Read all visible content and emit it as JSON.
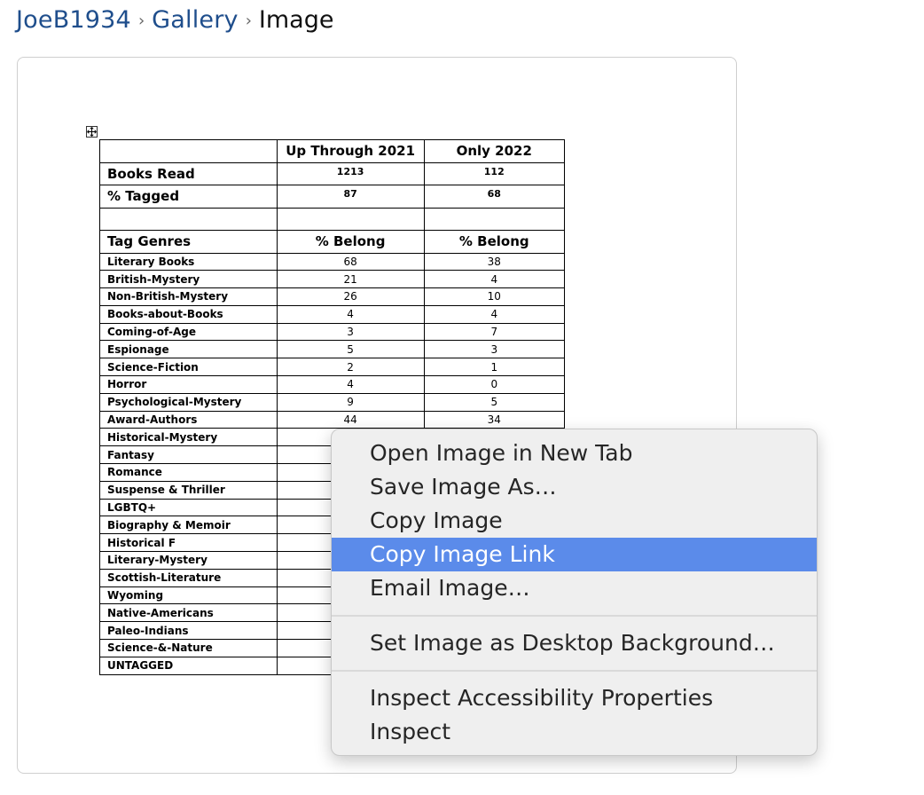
{
  "breadcrumb": {
    "user": "JoeB1934",
    "gallery": "Gallery",
    "current": "Image",
    "separator": "›"
  },
  "table": {
    "header": [
      "",
      "Up Through 2021",
      "Only 2022"
    ],
    "summary_rows": [
      [
        "Books Read",
        "1213",
        "112"
      ],
      [
        "% Tagged",
        "87",
        "68"
      ],
      [
        "",
        "",
        ""
      ],
      [
        "Tag Genres",
        "% Belong",
        "% Belong"
      ]
    ],
    "rows": [
      [
        "Literary Books",
        "68",
        "38"
      ],
      [
        "British-Mystery",
        "21",
        "4"
      ],
      [
        "Non-British-Mystery",
        "26",
        "10"
      ],
      [
        "Books-about-Books",
        "4",
        "4"
      ],
      [
        "Coming-of-Age",
        "3",
        "7"
      ],
      [
        "Espionage",
        "5",
        "3"
      ],
      [
        "Science-Fiction",
        "2",
        "1"
      ],
      [
        "Horror",
        "4",
        "0"
      ],
      [
        "Psychological-Mystery",
        "9",
        "5"
      ],
      [
        "Award-Authors",
        "44",
        "34"
      ],
      [
        "Historical-Mystery",
        "",
        ""
      ],
      [
        "Fantasy",
        "",
        ""
      ],
      [
        "Romance",
        "",
        ""
      ],
      [
        "Suspense & Thriller",
        "",
        ""
      ],
      [
        "LGBTQ+",
        "",
        ""
      ],
      [
        "Biography & Memoir",
        "",
        ""
      ],
      [
        "Historical F",
        "",
        ""
      ],
      [
        "Literary-Mystery",
        "",
        ""
      ],
      [
        "Scottish-Literature",
        "",
        ""
      ],
      [
        "Wyoming",
        "",
        ""
      ],
      [
        "Native-Americans",
        "",
        ""
      ],
      [
        "Paleo-Indians",
        "",
        ""
      ],
      [
        "Science-&-Nature",
        "",
        ""
      ],
      [
        "UNTAGGED",
        "",
        ""
      ]
    ]
  },
  "context_menu": {
    "items": [
      "Open Image in New Tab",
      "Save Image As…",
      "Copy Image",
      "Copy Image Link",
      "Email Image…",
      "Set Image as Desktop Background…",
      "Inspect Accessibility Properties",
      "Inspect"
    ],
    "highlighted": "Copy Image Link",
    "highlight_color": "#5b8bea"
  }
}
